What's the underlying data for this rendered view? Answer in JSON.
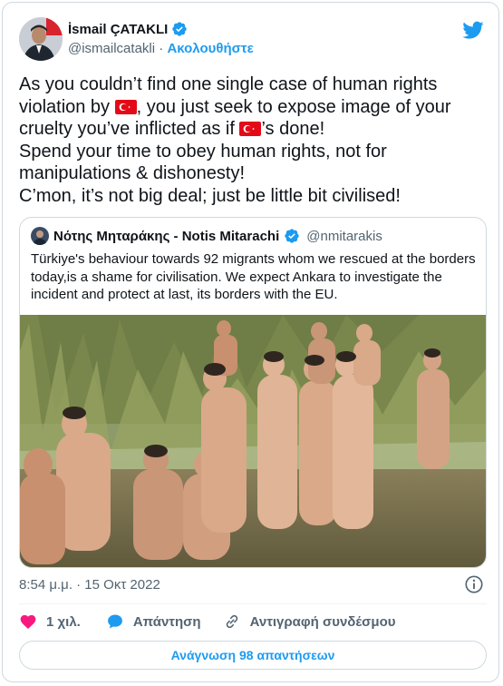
{
  "author": {
    "name": "İsmail ÇATAKLI",
    "handle": "@ismailcatakli",
    "follow_label": "Ακολουθήστε",
    "separator": " · "
  },
  "tweet": {
    "line1_a": "As you couldn’t find one single case of human rights violation by ",
    "line1_b": ", you just seek to expose image of your cruelty you’ve inflicted as if ",
    "line1_c": "’s done!",
    "line2": "Spend your time to obey human rights, not for manipulations & dishonesty!",
    "line3": "C’mon, it’s not big deal; just be little bit civilised!"
  },
  "quoted": {
    "name": "Νότης Μηταράκης - Notis Mitarachi",
    "handle": "@nmitarakis",
    "text": "Türkiye's behaviour towards 92 migrants whom we rescued at the borders today,is a shame for civilisation. We expect Ankara to investigate the incident and protect at last, its borders with the EU."
  },
  "meta": {
    "timestamp": "8:54 μ.μ. · 15 Οκτ 2022"
  },
  "actions": {
    "likes": "1 χιλ.",
    "reply_label": "Απάντηση",
    "copy_link_label": "Αντιγραφή συνδέσμου"
  },
  "read_replies_label": "Ανάγνωση 98 απαντήσεων",
  "colors": {
    "accent": "#1d9bf0",
    "like": "#f91880",
    "flag_red": "#e30a17",
    "muted": "#536471"
  },
  "icons": [
    "verified-badge-icon",
    "twitter-bird-icon",
    "turkey-flag-icon",
    "info-icon",
    "heart-icon",
    "reply-bubble-icon",
    "link-icon"
  ]
}
